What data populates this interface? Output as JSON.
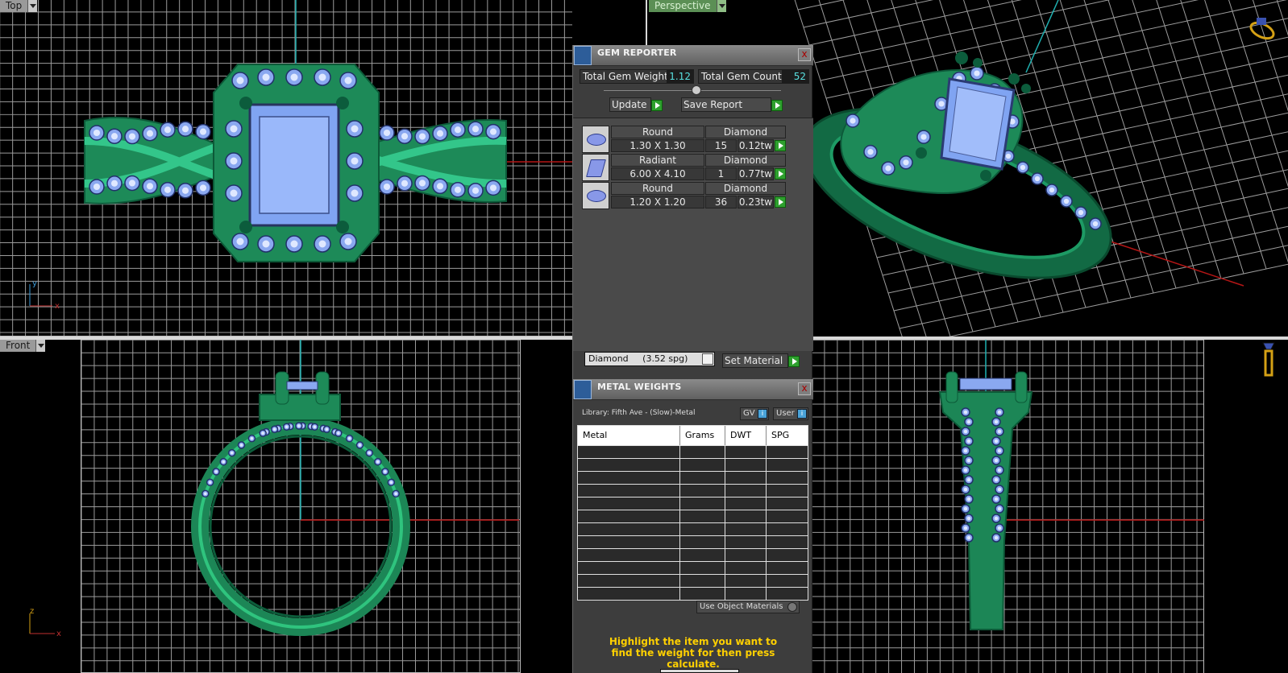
{
  "viewports": {
    "top": {
      "label": "Top",
      "axis_h": "x",
      "axis_v": "y"
    },
    "perspective": {
      "label": "Perspective"
    },
    "front": {
      "label": "Front",
      "axis_h": "x",
      "axis_v": "z"
    }
  },
  "gem_reporter": {
    "title": "GEM REPORTER",
    "close": "x",
    "total_weight_label": "Total Gem Weight",
    "total_weight": "1.12",
    "total_count_label": "Total Gem Count",
    "total_count": "52",
    "update_label": "Update",
    "save_label": "Save Report",
    "gems": [
      {
        "shape": "Round",
        "size": "1.30 X 1.30",
        "material": "Diamond",
        "count": "15",
        "weight": "0.12tw",
        "icon": "round-gem-icon"
      },
      {
        "shape": "Radiant",
        "size": "6.00 X 4.10",
        "material": "Diamond",
        "count": "1",
        "weight": "0.77tw",
        "icon": "radiant-gem-icon"
      },
      {
        "shape": "Round",
        "size": "1.20 X 1.20",
        "material": "Diamond",
        "count": "36",
        "weight": "0.23tw",
        "icon": "round-gem-icon"
      }
    ],
    "material_select": "Diamond     (3.52 spg)",
    "set_material_label": "Set Material"
  },
  "metal_weights": {
    "title": "METAL WEIGHTS",
    "close": "x",
    "library": "Library: Fifth Ave - (Slow)-Metal",
    "gv_label": "GV",
    "user_label": "User",
    "columns": [
      "Metal",
      "Grams",
      "DWT",
      "SPG"
    ],
    "use_object_materials": "Use Object Materials",
    "instruction": "Highlight the item you want to find the weight for then press calculate."
  },
  "colors": {
    "ring": "#1a8a5a",
    "gem": "#8aa8f0",
    "accent_green": "#2ea02e",
    "value_cyan": "#58e0e0",
    "notice_yellow": "#ffd000"
  }
}
